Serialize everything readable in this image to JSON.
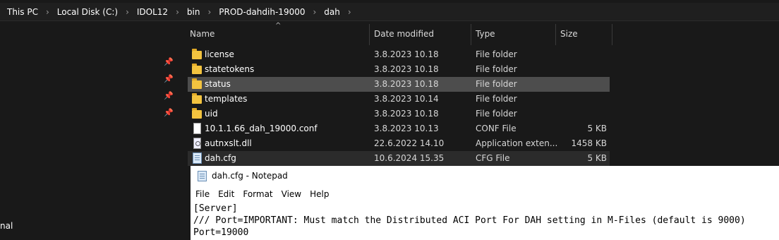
{
  "breadcrumb": [
    "This PC",
    "Local Disk (C:)",
    "IDOL12",
    "bin",
    "PROD-dahdih-19000",
    "dah"
  ],
  "nav_label": "nal",
  "columns": {
    "name": "Name",
    "date": "Date modified",
    "type": "Type",
    "size": "Size"
  },
  "files": [
    {
      "icon": "folder-icon",
      "name": "license",
      "date": "3.8.2023 10.18",
      "type": "File folder",
      "size": ""
    },
    {
      "icon": "folder-icon",
      "name": "statetokens",
      "date": "3.8.2023 10.18",
      "type": "File folder",
      "size": ""
    },
    {
      "icon": "folder-icon",
      "name": "status",
      "date": "3.8.2023 10.18",
      "type": "File folder",
      "size": "",
      "selected": true
    },
    {
      "icon": "folder-icon",
      "name": "templates",
      "date": "3.8.2023 10.14",
      "type": "File folder",
      "size": ""
    },
    {
      "icon": "folder-icon",
      "name": "uid",
      "date": "3.8.2023 10.18",
      "type": "File folder",
      "size": ""
    },
    {
      "icon": "document-icon",
      "name": "10.1.1.66_dah_19000.conf",
      "date": "3.8.2023 10.13",
      "type": "CONF File",
      "size": "5 KB"
    },
    {
      "icon": "dll-icon",
      "name": "autnxslt.dll",
      "date": "22.6.2022 14.10",
      "type": "Application exten...",
      "size": "1458 KB"
    },
    {
      "icon": "cfg-file-icon",
      "name": "dah.cfg",
      "date": "10.6.2024 15.35",
      "type": "CFG File",
      "size": "5 KB"
    }
  ],
  "notepad": {
    "title": "dah.cfg - Notepad",
    "menu": [
      "File",
      "Edit",
      "Format",
      "View",
      "Help"
    ],
    "lines": [
      "[Server]",
      "/// Port=IMPORTANT: Must match the Distributed ACI Port For DAH setting in M-Files (default is 9000)",
      "Port=19000"
    ]
  }
}
